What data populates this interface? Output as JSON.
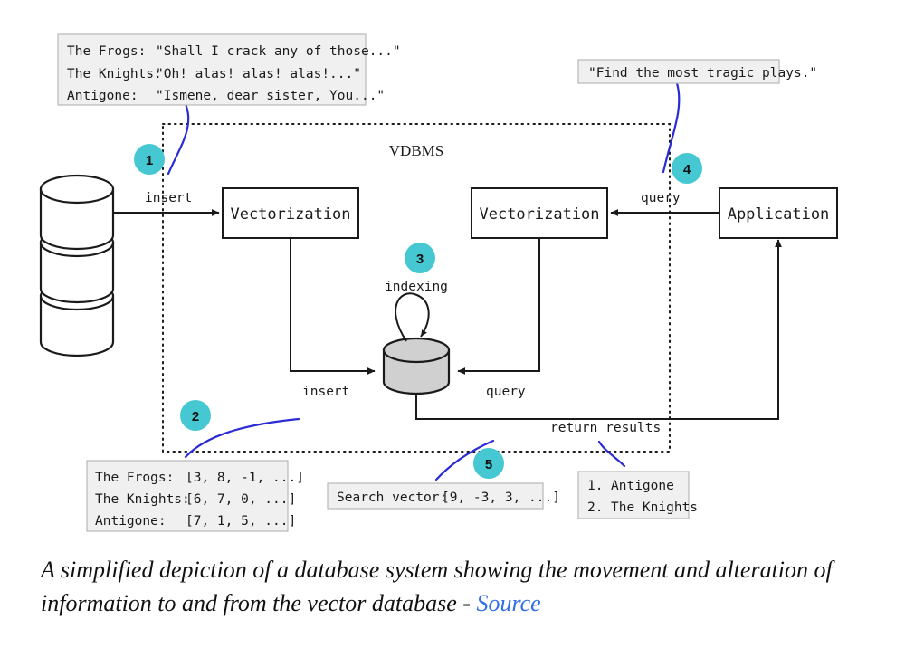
{
  "figure": {
    "system_label": "VDBMS",
    "caption_text": "A simplified depiction of a database system showing the movement and alteration of information to and from the vector database - ",
    "caption_link": "Source"
  },
  "colors": {
    "badge": "#45c8d2",
    "leader": "#2b2bd6",
    "link": "#2f6fe8",
    "vector_store_fill": "#d0d0d0",
    "panel_fill": "#f0f0f0"
  },
  "nodes": {
    "vectorization_insert": "Vectorization",
    "vectorization_query": "Vectorization",
    "application": "Application"
  },
  "edge_labels": {
    "insert_top": "insert",
    "insert_bottom": "insert",
    "query_top": "query",
    "query_bottom": "query",
    "indexing": "indexing",
    "return_results": "return results"
  },
  "badges": [
    {
      "id": "1",
      "label": "1"
    },
    {
      "id": "2",
      "label": "2"
    },
    {
      "id": "3",
      "label": "3"
    },
    {
      "id": "4",
      "label": "4"
    },
    {
      "id": "5",
      "label": "5"
    }
  ],
  "panels": {
    "raw_documents": {
      "rows": [
        {
          "name": "The Frogs:",
          "value": "\"Shall I crack any of those...\""
        },
        {
          "name": "The Knights:",
          "value": "\"Oh! alas! alas! alas!...\""
        },
        {
          "name": "Antigone:",
          "value": "\"Ismene, dear sister, You...\""
        }
      ]
    },
    "user_query": {
      "text": "\"Find the most tragic plays.\""
    },
    "document_vectors": {
      "rows": [
        {
          "name": "The Frogs:",
          "value": "[3, 8, -1, ...]"
        },
        {
          "name": "The Knights:",
          "value": "[6, 7, 0, ...]"
        },
        {
          "name": "Antigone:",
          "value": "[7, 1, 5, ...]"
        }
      ]
    },
    "search_vector": {
      "label": "Search vector:",
      "value": "[9, -3, 3, ...]"
    },
    "results": {
      "rows": [
        {
          "rank": "1.",
          "title": "Antigone"
        },
        {
          "rank": "2.",
          "title": "The Knights"
        }
      ]
    }
  }
}
